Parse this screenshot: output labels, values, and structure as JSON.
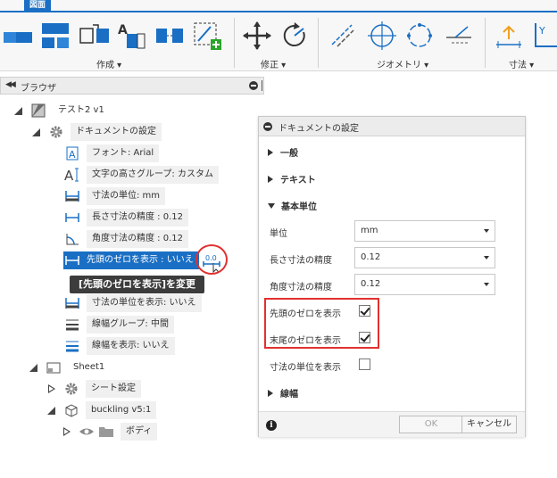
{
  "ribbon": {
    "tab_label": "図面",
    "groups": {
      "create": "作成 ▾",
      "modify": "修正 ▾",
      "geometry": "ジオメトリ ▾",
      "dimension": "寸法 ▾"
    }
  },
  "browser": {
    "title": "ブラウザ",
    "tree": {
      "root": "テスト2 v1",
      "doc_settings": "ドキュメントの設定",
      "font": "フォント: Arial",
      "text_height": "文字の高さグループ: カスタム",
      "unit": "寸法の単位: mm",
      "linear_precision": "長さ寸法の精度 : 0.12",
      "angular_precision": "角度寸法の精度 : 0.12",
      "leading_zero": "先頭のゼロを表示 : いいえ",
      "show_unit": "寸法の単位を表示: いいえ",
      "line_weight_group": "線幅グループ: 中間",
      "show_line_weight": "線幅を表示: いいえ",
      "sheet": "Sheet1",
      "sheet_settings": "シート設定",
      "component": "buckling v5:1",
      "body": "ボディ"
    },
    "zero_button_text": "0.0"
  },
  "tooltip": "[先頭のゼロを表示]を変更",
  "dialog": {
    "title": "ドキュメントの設定",
    "sections": {
      "general": "一般",
      "text": "テキスト",
      "base_units": "基本単位",
      "line_weight": "線幅"
    },
    "fields": {
      "unit_label": "単位",
      "unit_value": "mm",
      "linear_label": "長さ寸法の精度",
      "linear_value": "0.12",
      "angular_label": "角度寸法の精度",
      "angular_value": "0.12",
      "leading_zero_label": "先頭のゼロを表示",
      "trailing_zero_label": "末尾のゼロを表示",
      "show_unit_label": "寸法の単位を表示"
    },
    "checks": {
      "leading_zero": true,
      "trailing_zero": true,
      "show_unit": false
    },
    "ok": "OK",
    "cancel": "キャンセル",
    "info_glyph": "i"
  },
  "colors": {
    "accent": "#1a6fc4",
    "highlight": "#e23030",
    "selected_text": "#ffffff"
  }
}
